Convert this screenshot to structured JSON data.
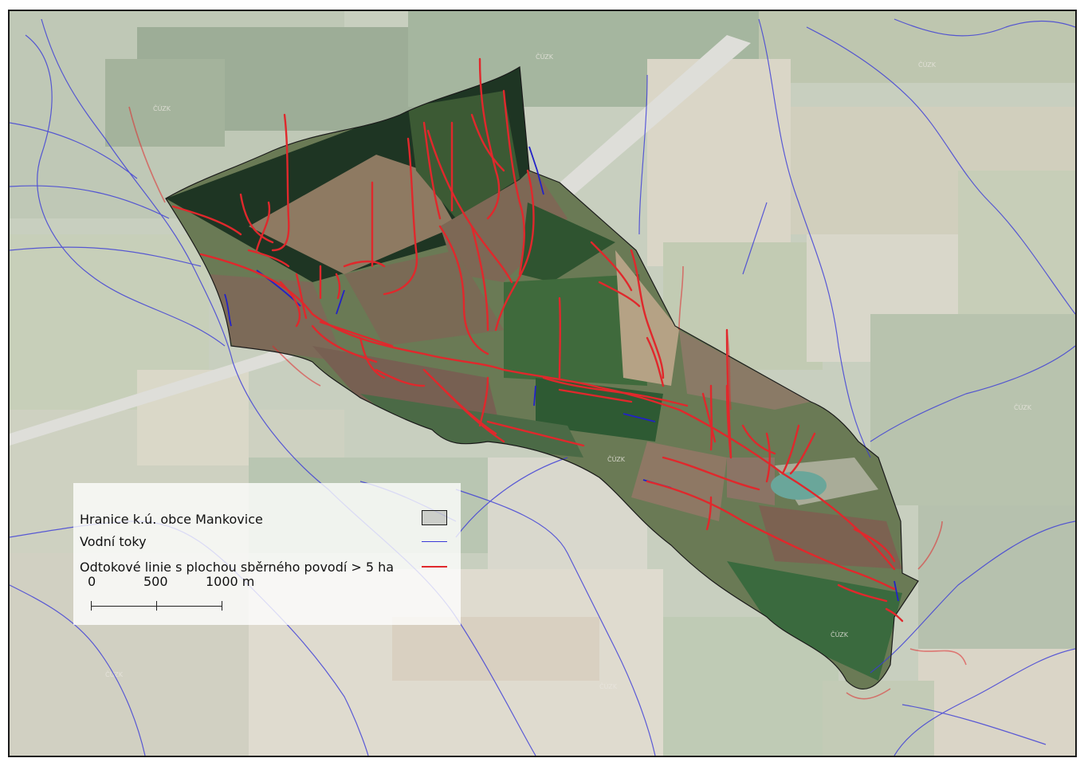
{
  "legend": {
    "boundary_label": "Hranice k.ú. obce Mankovice",
    "streams_label": "Vodní toky",
    "runoff_label": "Odtokové linie s plochou sběrného povodí > 5 ha"
  },
  "scale_bar": {
    "labels": [
      "0",
      "500",
      "1000 m"
    ]
  },
  "watermark": "ČÚZK",
  "colors": {
    "streams": "#3a3ad8",
    "runoff": "#e0282c",
    "boundary": "#1a1a1a",
    "outside_wash": "#f2f2f2"
  }
}
